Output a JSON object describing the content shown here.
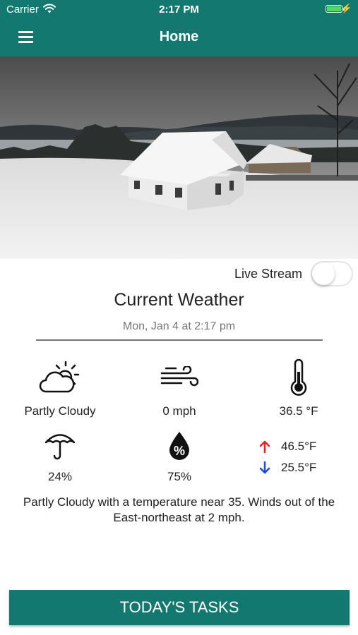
{
  "status_bar": {
    "carrier": "Carrier",
    "time": "2:17 PM"
  },
  "nav": {
    "title": "Home",
    "menu_icon": "hamburger-menu-icon"
  },
  "camera": {
    "description_icon": "webcam-image"
  },
  "live_stream": {
    "label": "Live Stream",
    "enabled": false
  },
  "weather": {
    "title": "Current Weather",
    "date": "Mon, Jan 4 at 2:17 pm",
    "condition": {
      "icon": "partly-cloudy-icon",
      "label": "Partly Cloudy"
    },
    "wind": {
      "icon": "wind-icon",
      "label": "0 mph"
    },
    "temperature": {
      "icon": "thermometer-icon",
      "label": "36.5 °F"
    },
    "precip_chance": {
      "icon": "umbrella-icon",
      "label": "24%"
    },
    "humidity": {
      "icon": "humidity-drop-icon",
      "label": "75%"
    },
    "high": {
      "icon": "arrow-up-icon",
      "label": "46.5°F",
      "color": "#e8232a"
    },
    "low": {
      "icon": "arrow-down-icon",
      "label": "25.5°F",
      "color": "#1f4fd6"
    },
    "summary": "Partly Cloudy with a temperature near 35. Winds out of the East-northeast at 2 mph."
  },
  "tasks_button": {
    "label": "TODAY'S TASKS"
  },
  "colors": {
    "brand": "#137970",
    "battery": "#4cd964"
  }
}
